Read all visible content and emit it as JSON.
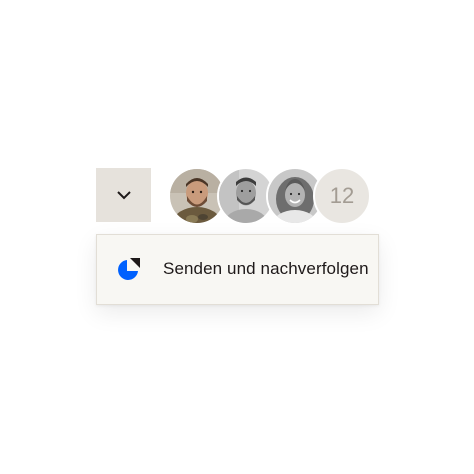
{
  "toggle": {
    "icon": "chevron-down-icon"
  },
  "avatars": {
    "people": [
      {
        "name": "person-1",
        "style": "color"
      },
      {
        "name": "person-2",
        "style": "grayscale"
      },
      {
        "name": "person-3",
        "style": "grayscale"
      }
    ],
    "more_count": "12"
  },
  "menu": {
    "items": [
      {
        "icon": "send-and-track-icon",
        "label": "Senden und nachverfolgen"
      }
    ]
  },
  "colors": {
    "brand_blue": "#0061fe",
    "toggle_bg": "#e6e2dc",
    "menu_bg": "#f8f7f3",
    "text": "#1e1919"
  }
}
